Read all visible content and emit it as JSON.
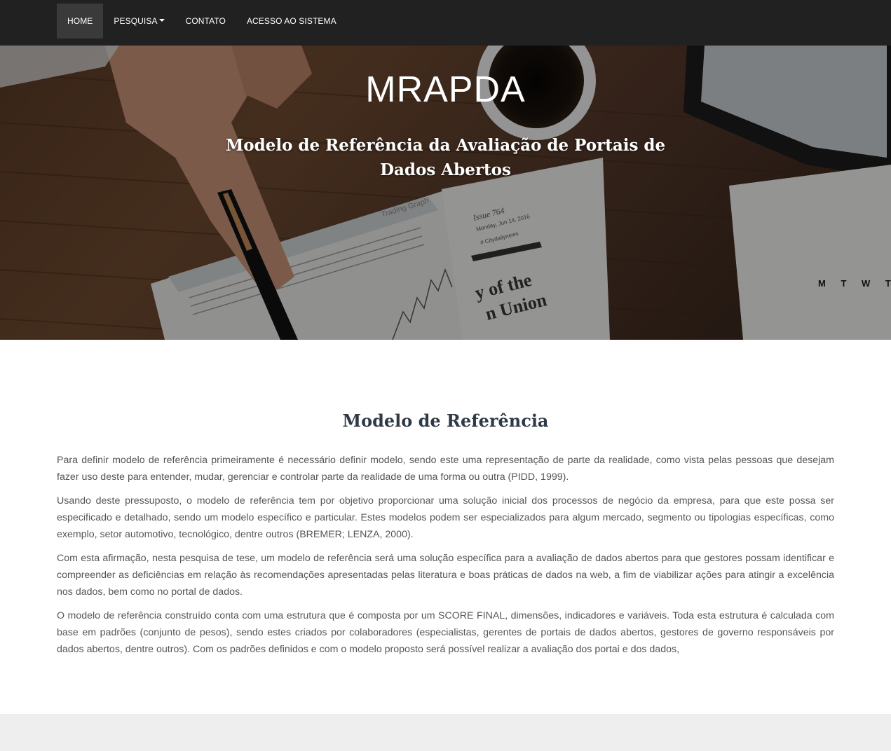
{
  "nav": {
    "items": [
      {
        "label": "HOME",
        "active": true
      },
      {
        "label": "PESQUISA",
        "has_dropdown": true
      },
      {
        "label": "CONTATO"
      },
      {
        "label": "ACESSO AO SISTEMA"
      }
    ]
  },
  "hero": {
    "title": "MRAPDA",
    "subtitle": "Modelo de Referência da Avaliação de Portais de Dados Abertos",
    "background": "photo of a desk with newspapers, coffee cup, hand holding a pen and a tablet",
    "photo_text": {
      "trading_graph": "Trading Graph",
      "issue": "Issue 764",
      "date": "Monday, Jun 14, 2016",
      "hashtag": "# Citydailynews",
      "headline_1": "y of the",
      "headline_2": "n Union",
      "weekdays": "M T W T"
    }
  },
  "section": {
    "title": "Modelo de Referência",
    "paragraphs": [
      "Para definir modelo de referência primeiramente é necessário definir modelo, sendo este uma representação de parte da realidade, como vista pelas pessoas que desejam fazer uso deste para entender, mudar, gerenciar e controlar parte da realidade de uma forma ou outra (PIDD, 1999).",
      "Usando deste pressuposto, o modelo de referência tem por objetivo proporcionar uma solução inicial dos processos de negócio da empresa, para que este possa ser especificado e detalhado, sendo um modelo específico e particular. Estes modelos podem ser especializados para algum mercado, segmento ou tipologias específicas, como exemplo, setor automotivo, tecnológico, dentre outros (BREMER; LENZA, 2000).",
      "Com esta afirmação, nesta pesquisa de tese, um modelo de referência será uma solução específica para a avaliação de dados abertos para que gestores possam identificar e compreender as deficiências em relação às recomendações apresentadas pelas literatura e boas práticas de dados na web, a fim de viabilizar ações para atingir a excelência nos dados, bem como no portal de dados.",
      "O modelo de referência construído conta com uma estrutura que é composta por um SCORE FINAL, dimensões, indicadores e variáveis. Toda esta estrutura é calculada com base em padrões (conjunto de pesos), sendo estes criados por colaboradores (especialistas, gerentes de portais de dados abertos, gestores de governo responsáveis por dados abertos, dentre outros). Com os padrões definidos e com o modelo proposto será possível realizar a avaliação dos portai e dos dados,"
    ]
  },
  "colors": {
    "navbar": "#212121",
    "nav_active": "#3a3a3a",
    "section_title": "#2f3a46",
    "body_text": "#555555",
    "footer_band": "#eeeeee"
  }
}
